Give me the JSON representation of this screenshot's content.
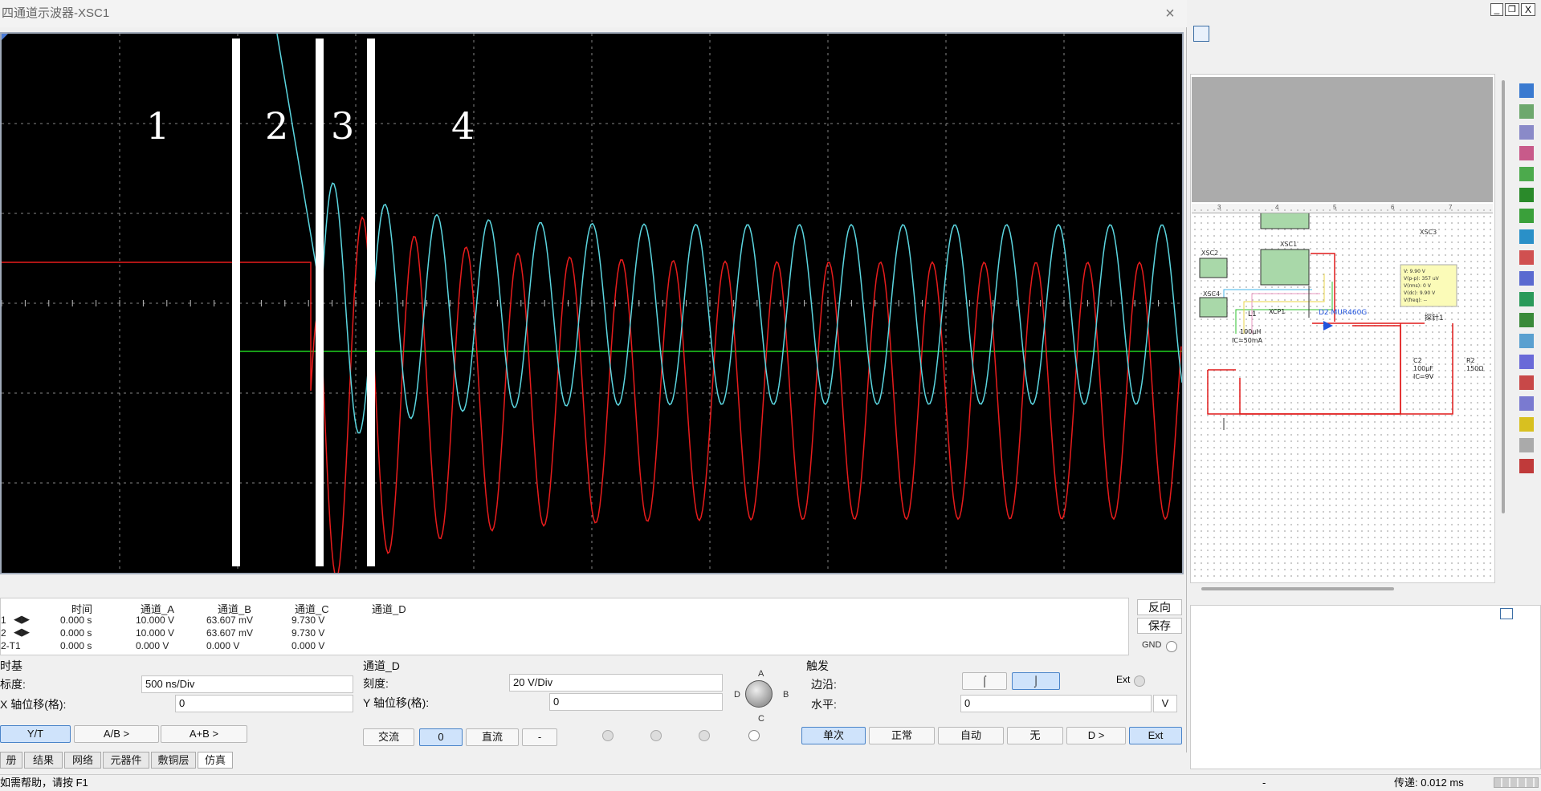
{
  "window": {
    "title": "四通道示波器-XSC1",
    "close_glyph": "×"
  },
  "screen": {
    "region_labels": [
      "1",
      "2",
      "3",
      "4"
    ],
    "colors": {
      "cyan": "#5bd6e0",
      "red": "#e81c1c",
      "green": "#1fcf1f",
      "grid": "#bfbfbf"
    }
  },
  "readout": {
    "headers": [
      "时间",
      "通道_A",
      "通道_B",
      "通道_C",
      "通道_D"
    ],
    "rows": [
      {
        "label": "1",
        "time": "0.000 s",
        "a": "10.000 V",
        "b": "63.607 mV",
        "c": "9.730 V"
      },
      {
        "label": "2",
        "time": "0.000 s",
        "a": "10.000 V",
        "b": "63.607 mV",
        "c": "9.730 V"
      },
      {
        "label": "2-T1",
        "time": "0.000 s",
        "a": "0.000 V",
        "b": "0.000 V",
        "c": "0.000 V"
      }
    ],
    "reverse_label": "反向",
    "save_label": "保存",
    "gnd_label": "GND"
  },
  "timebase": {
    "group_label": "时基",
    "scale_label": "标度:",
    "scale_value": "500 ns/Div",
    "xpos_label": "X 轴位移(格):",
    "xpos_value": "0",
    "modes": [
      "Y/T",
      "A/B >",
      "A+B >"
    ]
  },
  "channel_d": {
    "group_label": "通道_D",
    "scale_label": "刻度:",
    "scale_value": "20  V/Div",
    "ypos_label": "Y 轴位移(格):",
    "ypos_value": "0",
    "coupling": [
      "交流",
      "0",
      "直流",
      "-"
    ],
    "knob_labels": [
      "A",
      "B",
      "C",
      "D"
    ]
  },
  "trigger": {
    "group_label": "触发",
    "edge_label": "边沿:",
    "ext_label": "Ext",
    "level_label": "水平:",
    "level_value": "0",
    "level_unit": "V",
    "modes": [
      "单次",
      "正常",
      "自动",
      "无",
      "D >",
      "Ext"
    ]
  },
  "bottom_tabs": [
    "册",
    "结果",
    "网络",
    "元器件",
    "敷铜层",
    "仿真"
  ],
  "status": {
    "help": "如需帮助，请按 F1",
    "transfer": "传递: 0.012 ms",
    "dash": "-"
  },
  "app": {
    "win_min": "_",
    "win_max": "❐",
    "win_close": "X"
  },
  "schematic": {
    "labels": [
      "XSC3",
      "XSC1",
      "XSC2",
      "XSC4",
      "L1",
      "100μH",
      "IC=50mA",
      "D2 MUR460G",
      "探针1",
      "C2",
      "100μF",
      "IC=9V",
      "R2",
      "150Ω",
      "XCP1"
    ],
    "probe_text": [
      "V: 9.90 V",
      "V(p-p): 357 uV",
      "V(rms): 0 V",
      "V(dc): 9.90 V",
      "V(freq): --"
    ],
    "ruler": [
      "3",
      "4",
      "5",
      "6",
      "7"
    ]
  }
}
